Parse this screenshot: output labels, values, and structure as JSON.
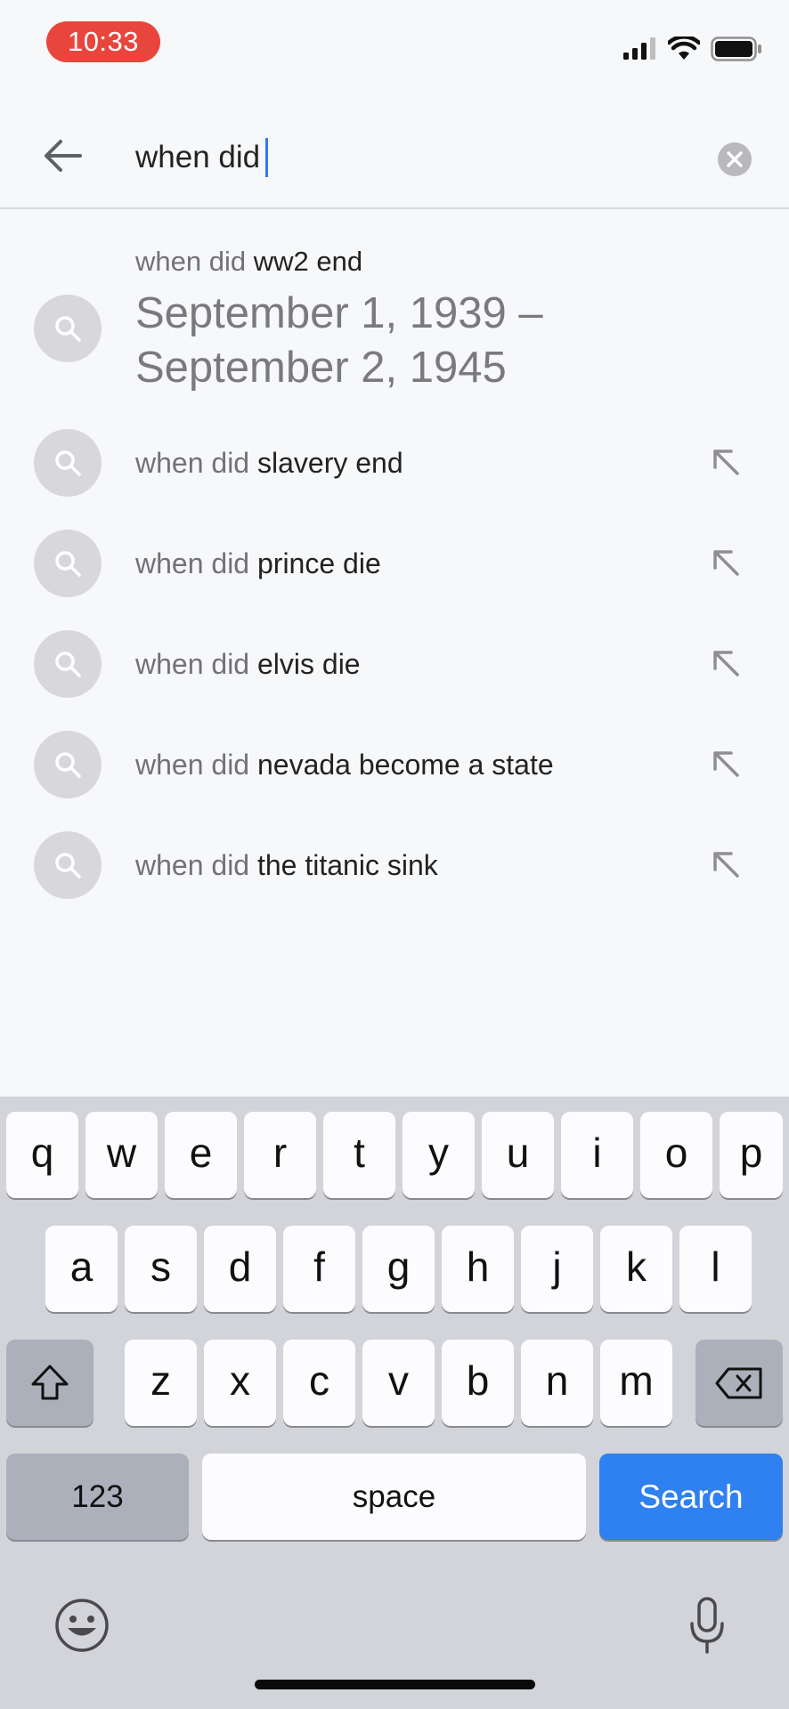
{
  "status_bar": {
    "time": "10:33"
  },
  "search": {
    "query": "when did"
  },
  "featured": {
    "prefix": "when did",
    "rest": "ww2 end",
    "answer_line1": "September 1, 1939 –",
    "answer_line2": "September 2, 1945"
  },
  "suggestions": [
    {
      "prefix": "when did",
      "rest": "slavery end"
    },
    {
      "prefix": "when did",
      "rest": "prince die"
    },
    {
      "prefix": "when did",
      "rest": "elvis die"
    },
    {
      "prefix": "when did",
      "rest": "nevada become a state"
    },
    {
      "prefix": "when did",
      "rest": "the titanic sink"
    }
  ],
  "keyboard": {
    "row1": [
      "q",
      "w",
      "e",
      "r",
      "t",
      "y",
      "u",
      "i",
      "o",
      "p"
    ],
    "row2": [
      "a",
      "s",
      "d",
      "f",
      "g",
      "h",
      "j",
      "k",
      "l"
    ],
    "row3": [
      "z",
      "x",
      "c",
      "v",
      "b",
      "n",
      "m"
    ],
    "numbers_label": "123",
    "space_label": "space",
    "search_label": "Search"
  },
  "colors": {
    "accent": "#2f80f0",
    "time_pill": "#e8453c",
    "caret": "#3478f6"
  },
  "icons": {
    "back": "arrow-left-icon",
    "clear": "clear-circle-icon",
    "search": "search-icon",
    "fill": "arrow-up-left-icon",
    "shift": "shift-icon",
    "delete": "backspace-icon",
    "emoji": "emoji-icon",
    "mic": "microphone-icon"
  }
}
